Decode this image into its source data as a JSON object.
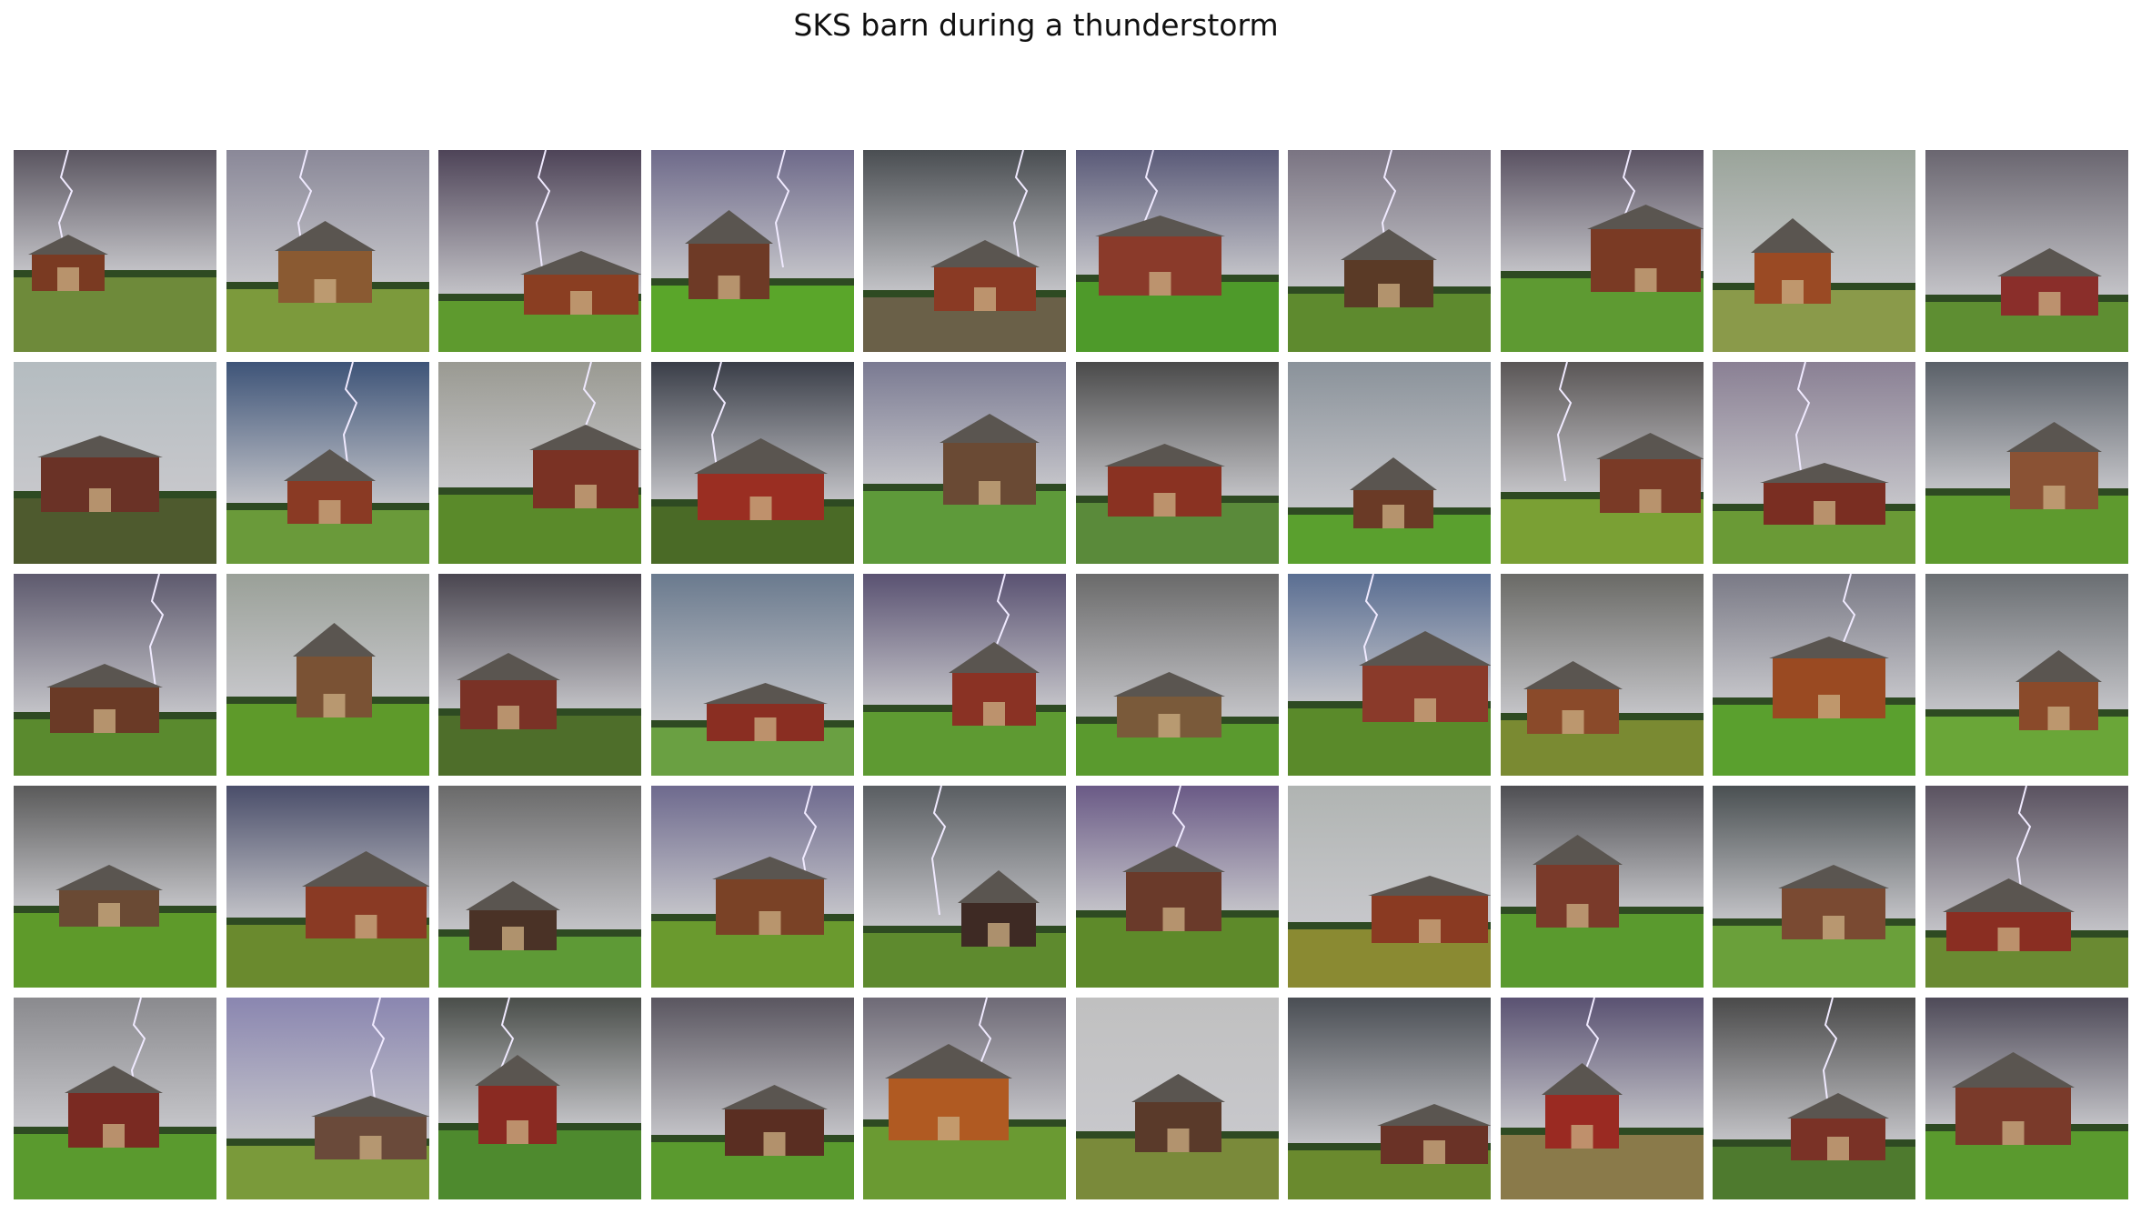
{
  "title": "SKS barn during a thunderstorm",
  "grid": {
    "rows": 5,
    "cols": 10,
    "images": [
      {
        "sky": "#5a5560",
        "grass": "#6e8a3a",
        "barn": "#7a3a22",
        "bolt": true
      },
      {
        "sky": "#8a8898",
        "grass": "#7c9a3c",
        "barn": "#8a5a32",
        "bolt": true
      },
      {
        "sky": "#4e4458",
        "grass": "#5e9a2e",
        "barn": "#8a3e22",
        "bolt": true
      },
      {
        "sky": "#6e6a8a",
        "grass": "#5aa62a",
        "barn": "#6e3a26",
        "bolt": true
      },
      {
        "sky": "#4a4e52",
        "grass": "#6a6048",
        "barn": "#8a3a24",
        "bolt": true
      },
      {
        "sky": "#5a5a78",
        "grass": "#4e9a2a",
        "barn": "#8a3a2a",
        "bolt": true
      },
      {
        "sky": "#7a7482",
        "grass": "#5e8a2e",
        "barn": "#5a3a26",
        "bolt": true
      },
      {
        "sky": "#5a5262",
        "grass": "#5e9a32",
        "barn": "#7a3a24",
        "bolt": true
      },
      {
        "sky": "#9aa49a",
        "grass": "#8a9a4a",
        "barn": "#9a4a24",
        "bolt": false
      },
      {
        "sky": "#6a6670",
        "grass": "#5e8e32",
        "barn": "#8a2e2a",
        "bolt": false
      },
      {
        "sky": "#b4bcc0",
        "grass": "#4e5a2e",
        "barn": "#6a3226",
        "bolt": false
      },
      {
        "sky": "#3e5478",
        "grass": "#6a9a3a",
        "barn": "#8a3a24",
        "bolt": true
      },
      {
        "sky": "#9a9a92",
        "grass": "#5a8a2a",
        "barn": "#7a3224",
        "bolt": true
      },
      {
        "sky": "#3a3e48",
        "grass": "#4a6a26",
        "barn": "#9a2e22",
        "bolt": true
      },
      {
        "sky": "#7a7a92",
        "grass": "#5e9a3a",
        "barn": "#6a4a34",
        "bolt": false
      },
      {
        "sky": "#4a4a4a",
        "grass": "#5a8a3a",
        "barn": "#8a3222",
        "bolt": false
      },
      {
        "sky": "#8a929a",
        "grass": "#5aa02e",
        "barn": "#6a3a26",
        "bolt": false
      },
      {
        "sky": "#5a5656",
        "grass": "#7aa034",
        "barn": "#7a3a26",
        "bolt": true
      },
      {
        "sky": "#8a8094",
        "grass": "#6a9a36",
        "barn": "#7a2e22",
        "bolt": true
      },
      {
        "sky": "#5a6068",
        "grass": "#5e9a2e",
        "barn": "#8a5234",
        "bolt": false
      },
      {
        "sky": "#5e5a6e",
        "grass": "#5a8a2e",
        "barn": "#6a3a26",
        "bolt": true
      },
      {
        "sky": "#9aa098",
        "grass": "#5e9a2a",
        "barn": "#7a5234",
        "bolt": false
      },
      {
        "sky": "#4a4650",
        "grass": "#4e6e2a",
        "barn": "#7a3226",
        "bolt": false
      },
      {
        "sky": "#6a7a8e",
        "grass": "#6aa042",
        "barn": "#8a2e22",
        "bolt": false
      },
      {
        "sky": "#5a5272",
        "grass": "#5e9a32",
        "barn": "#8a3224",
        "bolt": true
      },
      {
        "sky": "#6a6a6a",
        "grass": "#5a9a2e",
        "barn": "#7a5a3a",
        "bolt": false
      },
      {
        "sky": "#5a6e92",
        "grass": "#5a8a2a",
        "barn": "#8a3a2a",
        "bolt": true
      },
      {
        "sky": "#6a6a66",
        "grass": "#7a8a32",
        "barn": "#8a4a2a",
        "bolt": false
      },
      {
        "sky": "#7a7a86",
        "grass": "#5aa02e",
        "barn": "#9a4a22",
        "bolt": true
      },
      {
        "sky": "#6a6e72",
        "grass": "#6aa638",
        "barn": "#8a4a2a",
        "bolt": false
      },
      {
        "sky": "#5a5a5a",
        "grass": "#5e9a2a",
        "barn": "#6a4a34",
        "bolt": false
      },
      {
        "sky": "#4a4e6a",
        "grass": "#6a8a2e",
        "barn": "#8a3a24",
        "bolt": false
      },
      {
        "sky": "#6a6a6a",
        "grass": "#5e9a36",
        "barn": "#4a3226",
        "bolt": false
      },
      {
        "sky": "#6e6a8e",
        "grass": "#6a9a2e",
        "barn": "#7a4226",
        "bolt": true
      },
      {
        "sky": "#5a5e62",
        "grass": "#5e8a2e",
        "barn": "#3e2a24",
        "bolt": true
      },
      {
        "sky": "#6a5a86",
        "grass": "#5e8a2a",
        "barn": "#6a3a2a",
        "bolt": true
      },
      {
        "sky": "#b0b4b2",
        "grass": "#8a8a32",
        "barn": "#8a3a22",
        "bolt": false
      },
      {
        "sky": "#4e4e52",
        "grass": "#5a9a2e",
        "barn": "#7a3a2a",
        "bolt": false
      },
      {
        "sky": "#4a5052",
        "grass": "#6aa03a",
        "barn": "#7a4a32",
        "bolt": false
      },
      {
        "sky": "#5a5260",
        "grass": "#6a8a32",
        "barn": "#8a2e22",
        "bolt": true
      },
      {
        "sky": "#8a8a8e",
        "grass": "#5a9a2e",
        "barn": "#7a2a22",
        "bolt": true
      },
      {
        "sky": "#8a86b0",
        "grass": "#7a9a3a",
        "barn": "#6a4a3a",
        "bolt": true
      },
      {
        "sky": "#4a4e4a",
        "grass": "#4e8a2e",
        "barn": "#8a2a22",
        "bolt": true
      },
      {
        "sky": "#5a5660",
        "grass": "#5a9a2e",
        "barn": "#5a2e22",
        "bolt": false
      },
      {
        "sky": "#6e6a76",
        "grass": "#6a9a32",
        "barn": "#b05a22",
        "bolt": true
      },
      {
        "sky": "#c0c0c0",
        "grass": "#7a8a3a",
        "barn": "#5a3a2a",
        "bolt": false
      },
      {
        "sky": "#4a4e54",
        "grass": "#6a8a2e",
        "barn": "#6a3226",
        "bolt": false
      },
      {
        "sky": "#5a5272",
        "grass": "#8a7a4a",
        "barn": "#9a2a22",
        "bolt": true
      },
      {
        "sky": "#4a4a4a",
        "grass": "#4e7a2e",
        "barn": "#7a3226",
        "bolt": true
      },
      {
        "sky": "#4e4a58",
        "grass": "#5a9a2e",
        "barn": "#7a3a2a",
        "bolt": false
      }
    ]
  }
}
